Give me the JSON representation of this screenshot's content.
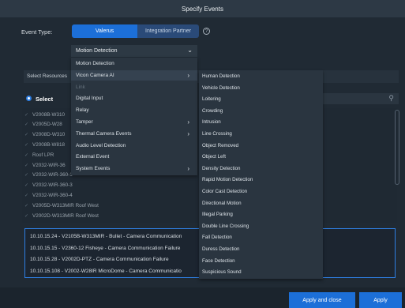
{
  "window": {
    "title": "Specify Events"
  },
  "event_type": {
    "label": "Event Type:",
    "options": [
      "Valerus",
      "Integration Partner"
    ],
    "help_icon": "help-circle-icon"
  },
  "event_select": {
    "value": "Motion Detection",
    "icon": "chevron-down-icon"
  },
  "resources": {
    "label": "Select Resources"
  },
  "select_row": {
    "radio_selected_label": "Select"
  },
  "cameras": [
    "V2008B-W310",
    "V2005D-W28",
    "V2008D-W310",
    "V2008B-W818",
    "Roof LPR",
    "V2032-WIR-36",
    "V2032-WIR-360-1",
    "V2032-WIR-360-3",
    "V2032-WIR-360-4",
    "V2005D-W313MIR Roof West",
    "V2002D-W313MIR Roof West"
  ],
  "selected": [
    "10.10.15.24 - V2105B-W313MIR - Bullet - Camera Communication",
    "10.10.15.15 - V2360-12 Fisheye - Camera Communication Failure",
    "10.10.15.28 - V2002D-PTZ - Camera Communication Failure",
    "10.10.15.108 - V2002-W28IR MicroDome - Camera Communicatio"
  ],
  "menu_primary": [
    {
      "label": "Motion Detection",
      "submenu": false,
      "dim": false
    },
    {
      "label": "Vicon Camera AI",
      "submenu": true,
      "dim": false
    },
    {
      "label": "Link",
      "submenu": false,
      "dim": true
    },
    {
      "label": "Digital Input",
      "submenu": false,
      "dim": false
    },
    {
      "label": "Relay",
      "submenu": false,
      "dim": false
    },
    {
      "label": "Tamper",
      "submenu": true,
      "dim": false
    },
    {
      "label": "Thermal Camera Events",
      "submenu": true,
      "dim": false
    },
    {
      "label": "Audio Level Detection",
      "submenu": false,
      "dim": false
    },
    {
      "label": "External Event",
      "submenu": false,
      "dim": false
    },
    {
      "label": "System Events",
      "submenu": true,
      "dim": false
    }
  ],
  "menu_secondary": [
    "Human Detection",
    "Vehicle Detection",
    "Loitering",
    "Crowding",
    "Intrusion",
    "Line Crossing",
    "Object Removed",
    "Object Left",
    "Density Detection",
    "Rapid Motion Detection",
    "Color Cast Detection",
    "Directional Motion",
    "Illegal Parking",
    "Double Line Crossing",
    "Fall Detection",
    "Duress Detection",
    "Face Detection",
    "Suspicious Sound"
  ],
  "footer": {
    "apply_close": "Apply and close",
    "apply": "Apply"
  },
  "colors": {
    "accent": "#1c6fd8",
    "background": "#1f2933",
    "menu": "#2a3540"
  }
}
